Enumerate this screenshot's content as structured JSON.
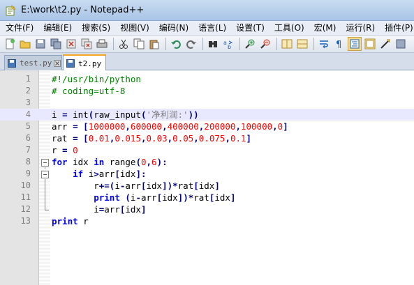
{
  "window": {
    "title": "E:\\work\\t2.py - Notepad++"
  },
  "menu": [
    "文件(F)",
    "编辑(E)",
    "搜索(S)",
    "视图(V)",
    "编码(N)",
    "语言(L)",
    "设置(T)",
    "工具(O)",
    "宏(M)",
    "运行(R)",
    "插件(P)"
  ],
  "toolbar": {
    "buttons": [
      "new-icon",
      "open-icon",
      "save-icon",
      "save-all-icon",
      "close-icon",
      "close-all-icon",
      "print-icon",
      "cut-icon",
      "copy-icon",
      "paste-icon",
      "undo-icon",
      "redo-icon",
      "find-icon",
      "replace-icon",
      "zoom-in-icon",
      "zoom-out-icon",
      "sync-v-icon",
      "sync-h-icon",
      "word-wrap-icon",
      "show-all-chars-icon",
      "indent-guide-icon",
      "doc-map-icon",
      "macro-record-icon",
      "macro-stop-icon"
    ]
  },
  "tabs": [
    {
      "label": "test.py",
      "active": false
    },
    {
      "label": "t2.py",
      "active": true
    }
  ],
  "editor": {
    "current_line": 4,
    "lines": [
      {
        "n": "1",
        "text": "#!/usr/bin/python"
      },
      {
        "n": "2",
        "text": "# coding=utf-8"
      },
      {
        "n": "3",
        "text": ""
      },
      {
        "n": "4",
        "text": "i = int(raw_input('净利润:'))"
      },
      {
        "n": "5",
        "text": "arr = [1000000,600000,400000,200000,100000,0]"
      },
      {
        "n": "6",
        "text": "rat = [0.01,0.015,0.03,0.05,0.075,0.1]"
      },
      {
        "n": "7",
        "text": "r = 0"
      },
      {
        "n": "8",
        "text": "for idx in range(0,6):"
      },
      {
        "n": "9",
        "text": "    if i>arr[idx]:"
      },
      {
        "n": "10",
        "text": "        r+=(i-arr[idx])*rat[idx]"
      },
      {
        "n": "11",
        "text": "        print (i-arr[idx])*rat[idx]"
      },
      {
        "n": "12",
        "text": "        i=arr[idx]"
      },
      {
        "n": "13",
        "text": "print r"
      }
    ]
  },
  "colors": {
    "keyword": "#0000ff",
    "comment": "#008000",
    "number": "#ff0000",
    "string": "#808080",
    "current_line": "#e8e8ff"
  }
}
